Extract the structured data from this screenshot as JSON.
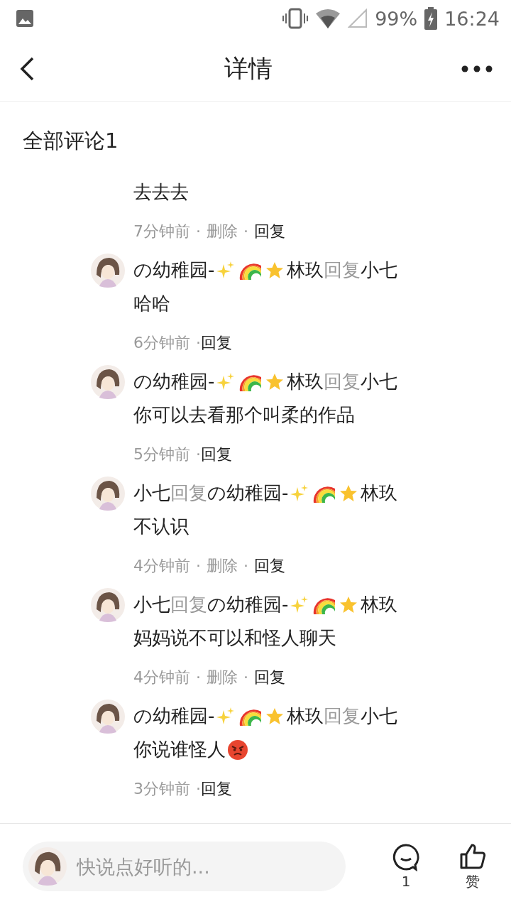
{
  "status_bar": {
    "battery": "99%",
    "time": "16:24"
  },
  "header": {
    "title": "详情"
  },
  "comments_heading": "全部评论1",
  "comments": [
    {
      "kind": "root",
      "body": [
        {
          "kind": "text",
          "text": "去去去"
        }
      ],
      "meta": {
        "time": "7分钟前",
        "actions": [
          {
            "kind": "delete",
            "separator": "·",
            "label": "删除"
          },
          {
            "kind": "reply",
            "separator": "·",
            "label": "回复"
          }
        ]
      }
    },
    {
      "kind": "reply",
      "author": [
        {
          "kind": "text",
          "text": "の幼稚园-"
        },
        {
          "kind": "sparkles"
        },
        {
          "kind": "rainbow"
        },
        {
          "kind": "star"
        },
        {
          "kind": "text",
          "text": "林玖"
        }
      ],
      "reply_word": "回复",
      "target": [
        {
          "kind": "text",
          "text": "小七"
        }
      ],
      "body": [
        {
          "kind": "text",
          "text": "哈哈"
        }
      ],
      "meta": {
        "time": "6分钟前",
        "actions": [
          {
            "kind": "reply",
            "separator": "·",
            "label": "回复"
          }
        ]
      }
    },
    {
      "kind": "reply",
      "author": [
        {
          "kind": "text",
          "text": "の幼稚园-"
        },
        {
          "kind": "sparkles"
        },
        {
          "kind": "rainbow"
        },
        {
          "kind": "star"
        },
        {
          "kind": "text",
          "text": "林玖"
        }
      ],
      "reply_word": "回复",
      "target": [
        {
          "kind": "text",
          "text": "小七"
        }
      ],
      "body": [
        {
          "kind": "text",
          "text": "你可以去看那个叫柔的作品"
        }
      ],
      "meta": {
        "time": "5分钟前",
        "actions": [
          {
            "kind": "reply",
            "separator": "·",
            "label": "回复"
          }
        ]
      }
    },
    {
      "kind": "reply",
      "author": [
        {
          "kind": "text",
          "text": "小七"
        }
      ],
      "reply_word": "回复",
      "target": [
        {
          "kind": "text",
          "text": "の幼稚园-"
        },
        {
          "kind": "sparkles"
        },
        {
          "kind": "rainbow"
        },
        {
          "kind": "star"
        },
        {
          "kind": "text",
          "text": "林玖"
        }
      ],
      "body": [
        {
          "kind": "text",
          "text": "不认识"
        }
      ],
      "meta": {
        "time": "4分钟前",
        "actions": [
          {
            "kind": "delete",
            "separator": "·",
            "label": "删除"
          },
          {
            "kind": "reply",
            "separator": "·",
            "label": "回复"
          }
        ]
      }
    },
    {
      "kind": "reply",
      "author": [
        {
          "kind": "text",
          "text": "小七"
        }
      ],
      "reply_word": "回复",
      "target": [
        {
          "kind": "text",
          "text": "の幼稚园-"
        },
        {
          "kind": "sparkles"
        },
        {
          "kind": "rainbow"
        },
        {
          "kind": "star"
        },
        {
          "kind": "text",
          "text": "林玖"
        }
      ],
      "body": [
        {
          "kind": "text",
          "text": "妈妈说不可以和怪人聊天"
        }
      ],
      "meta": {
        "time": "4分钟前",
        "actions": [
          {
            "kind": "delete",
            "separator": "·",
            "label": "删除"
          },
          {
            "kind": "reply",
            "separator": "·",
            "label": "回复"
          }
        ]
      }
    },
    {
      "kind": "reply",
      "author": [
        {
          "kind": "text",
          "text": "の幼稚园-"
        },
        {
          "kind": "sparkles"
        },
        {
          "kind": "rainbow"
        },
        {
          "kind": "star"
        },
        {
          "kind": "text",
          "text": "林玖"
        }
      ],
      "reply_word": "回复",
      "target": [
        {
          "kind": "text",
          "text": "小七"
        }
      ],
      "body": [
        {
          "kind": "text",
          "text": "你说谁怪人"
        },
        {
          "kind": "angry"
        }
      ],
      "meta": {
        "time": "3分钟前",
        "actions": [
          {
            "kind": "reply",
            "separator": "·",
            "label": "回复"
          }
        ]
      }
    }
  ],
  "footer": {
    "placeholder": "快说点好听的...",
    "comment_count": "1",
    "like_label": "赞"
  }
}
